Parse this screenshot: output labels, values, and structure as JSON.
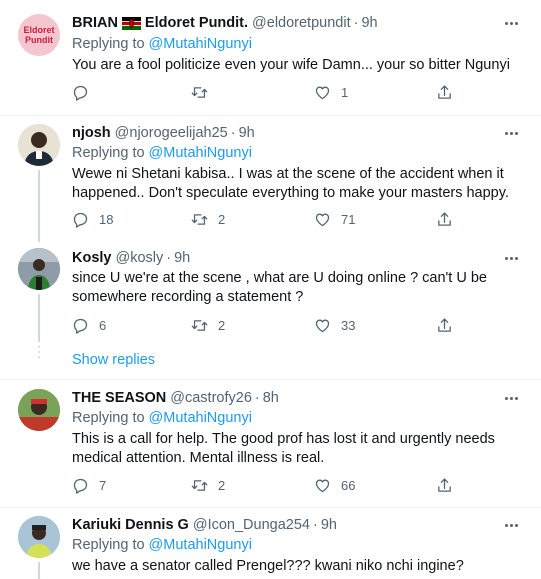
{
  "tweets": [
    {
      "name": "BRIAN",
      "has_flag": true,
      "display_suffix": "Eldoret Pundit.",
      "handle": "@eldoretpundit",
      "time": "9h",
      "replying_label": "Replying to",
      "mention": "@MutahiNgunyi",
      "text": "You are a fool politicize even your wife Damn... your so bitter Ngunyi",
      "replies": "",
      "retweets": "",
      "likes": "1",
      "avatar_text_1": "Eldoret",
      "avatar_text_2": "Pundit"
    },
    {
      "name": "njosh",
      "handle": "@njorogeelijah25",
      "time": "9h",
      "replying_label": "Replying to",
      "mention": "@MutahiNgunyi",
      "text": "Wewe ni Shetani kabisa.. I was at the scene of the accident when it happened.. Don't speculate everything to make your masters happy.",
      "replies": "18",
      "retweets": "2",
      "likes": "71"
    },
    {
      "name": "Kosly",
      "handle": "@kosly",
      "time": "9h",
      "text": "since U we're at the scene , what are U doing online ? can't U be somewhere recording a statement ?",
      "replies": "6",
      "retweets": "2",
      "likes": "33"
    },
    {
      "name": "THE SEASON",
      "handle": "@castrofy26",
      "time": "8h",
      "replying_label": "Replying to",
      "mention": "@MutahiNgunyi",
      "text": "This is a call for help. The good prof has lost it and urgently needs medical attention. Mental illness is real.",
      "replies": "7",
      "retweets": "2",
      "likes": "66"
    },
    {
      "name": "Kariuki Dennis G",
      "handle": "@Icon_Dunga254",
      "time": "9h",
      "replying_label": "Replying to",
      "mention": "@MutahiNgunyi",
      "text": "we have a senator called Prengel??? kwani niko nchi ingine?"
    }
  ],
  "show_replies_label": "Show replies",
  "separator": "·",
  "colors": {
    "accent": "#1d9bf0",
    "secondary_text": "#536471",
    "avatar_pink": "#f4c6cf",
    "avatar_text": "#d01b3e"
  },
  "icons": [
    "reply-icon",
    "retweet-icon",
    "like-icon",
    "share-icon",
    "more-icon",
    "kenya-flag-icon"
  ]
}
